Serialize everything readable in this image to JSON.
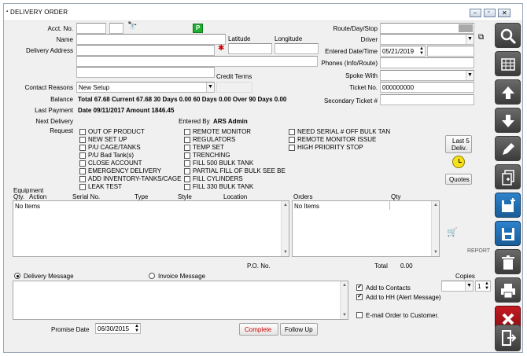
{
  "window": {
    "title": "DELIVERY ORDER"
  },
  "labels": {
    "acct_no": "Acct. No.",
    "name": "Name",
    "delivery_address": "Delivery Address",
    "latitude": "Latitude",
    "longitude": "Longitude",
    "credit_terms": "Credit Terms",
    "contact_reasons": "Contact Reasons",
    "balance": "Balance",
    "last_payment": "Last Payment",
    "next_delivery": "Next Delivery",
    "entered_by": "Entered By",
    "request": "Request",
    "route_day_stop": "Route/Day/Stop",
    "driver": "Driver",
    "entered_date_time": "Entered Date/Time",
    "phones": "Phones (Info/Route)",
    "spoke_with": "Spoke With",
    "ticket_no": "Ticket No.",
    "secondary_ticket": "Secondary Ticket #",
    "equipment": "Equipment",
    "qty": "Qty.",
    "action": "Action",
    "serial_no": "Serial No.",
    "type": "Type",
    "style": "Style",
    "location": "Location",
    "orders": "Orders",
    "orders_qty": "Qty",
    "po_no": "P.O. No.",
    "total": "Total",
    "copies": "Copies",
    "promise_date": "Promise Date"
  },
  "values": {
    "contact_reason": "New Setup",
    "balance_text": "Total 67.68  Current 67.68  30 Days 0.00  60 Days 0.00  Over 90 Days 0.00",
    "last_payment_text": "Date 09/11/2017  Amount 1846.45",
    "entered_by_name": "ARS Admin",
    "entered_date": "05/21/2019",
    "ticket_no": "000000000",
    "equipment_empty": "No Items",
    "orders_empty": "No Items",
    "total_value": "0.00",
    "copies_value": "1",
    "promise_date": "06/30/2015"
  },
  "requests": {
    "col1": [
      "OUT OF PRODUCT",
      "NEW SET UP",
      "P/U CAGE/TANKS",
      "P/U Bad Tank(s)",
      "CLOSE ACCOUNT",
      "EMERGENCY DELIVERY",
      "ADD INVENTORY-TANKS/CAGE",
      "LEAK TEST"
    ],
    "col2": [
      "REMOTE MONITOR",
      "REGULATORS",
      "TEMP SET",
      "TRENCHING",
      "FILL 500 BULK TANK",
      "PARTIAL FILL OF BULK SEE BE",
      "FILL CYLINDERS",
      "FILL 330 BULK TANK"
    ],
    "col3": [
      "NEED SERIAL # OFF BULK TAN",
      "REMOTE MONITOR ISSUE",
      "HIGH PRIORITY STOP"
    ]
  },
  "buttons": {
    "last5_line1": "Last 5",
    "last5_line2": "Deliv.",
    "quotes": "Quotes",
    "report": "REPORT",
    "complete": "Complete",
    "follow_up": "Follow Up"
  },
  "messages": {
    "delivery": "Delivery Message",
    "invoice": "Invoice Message"
  },
  "options": {
    "add_to_contacts": "Add to Contacts",
    "add_to_hh": "Add to HH (Alert Message)",
    "email_order": "E-mail Order to Customer."
  },
  "sidebar": [
    "search-icon",
    "table-icon",
    "arrow-up-icon",
    "arrow-down-icon",
    "pencil-icon",
    "copy-add-icon",
    "save-new-icon",
    "save-icon",
    "trash-icon",
    "print-icon",
    "close-icon",
    "exit-icon"
  ],
  "colors": {
    "complete_text": "#d00000",
    "side_blue": "#1f6fb5",
    "side_red": "#b3121a",
    "flag_green": "#1fae2e",
    "clock_yellow": "#f7e21a"
  }
}
